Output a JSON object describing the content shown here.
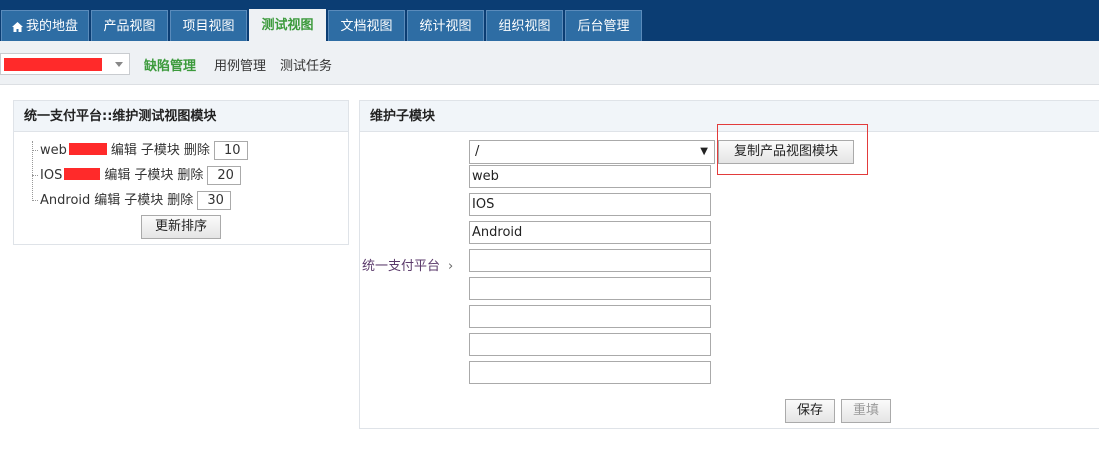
{
  "topnav": {
    "tabs": [
      {
        "label": "我的地盘",
        "active": false
      },
      {
        "label": "产品视图",
        "active": false
      },
      {
        "label": "项目视图",
        "active": false
      },
      {
        "label": "测试视图",
        "active": true
      },
      {
        "label": "文档视图",
        "active": false
      },
      {
        "label": "统计视图",
        "active": false
      },
      {
        "label": "组织视图",
        "active": false
      },
      {
        "label": "后台管理",
        "active": false
      }
    ]
  },
  "subnav": {
    "links": [
      {
        "label": "缺陷管理",
        "active": true
      },
      {
        "label": "用例管理",
        "active": false
      },
      {
        "label": "测试任务",
        "active": false
      }
    ]
  },
  "left_panel": {
    "title": "统一支付平台::维护测试视图模块",
    "items": [
      {
        "name": "web",
        "edit": "编辑",
        "child": "子模块",
        "delete": "删除",
        "order": "10"
      },
      {
        "name": "IOS",
        "edit": "编辑",
        "child": "子模块",
        "delete": "删除",
        "order": "20"
      },
      {
        "name": "Android",
        "edit": "编辑",
        "child": "子模块",
        "delete": "删除",
        "order": "30"
      }
    ],
    "update_order_label": "更新排序"
  },
  "right_panel": {
    "title": "维护子模块",
    "parent_label": "统一支付平台",
    "parent_select_value": "/",
    "copy_button_label": "复制产品视图模块",
    "children": [
      "web",
      "IOS",
      "Android",
      "",
      "",
      "",
      "",
      ""
    ],
    "save_label": "保存",
    "reset_label": "重填"
  },
  "colors": {
    "nav_bg": "#0b3d73",
    "tab_bg": "#2e6da4",
    "active_green": "#3c9a3c",
    "redaction": "#ff2a2a",
    "highlight": "#e23b3b"
  }
}
